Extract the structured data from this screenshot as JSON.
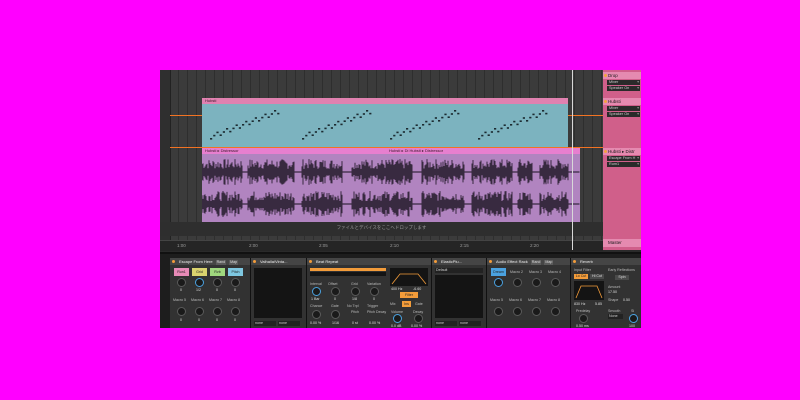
{
  "arrangement": {
    "midi_clip_name": "Hubsti",
    "audio_clip_names": [
      "Hubsti ▸ Distressor",
      "Hubsti ▸ Di Hubsti ▸ Distressor"
    ],
    "drop_hint": "ファイルとデバイスをここへドロップします",
    "ruler_ticks": [
      "1:00",
      "2:00",
      "2:05",
      "2:10",
      "2:15",
      "2:20"
    ]
  },
  "tracks": [
    {
      "title": "Drop",
      "items": [
        "Mixer",
        "Speaker On"
      ]
    },
    {
      "title": "Hubsti",
      "items": [
        "Mixer",
        "Speaker On"
      ]
    },
    {
      "title": "Hubsti ▸ Distr",
      "items": [
        "Escape From H",
        "Rum1"
      ]
    }
  ],
  "master_label": "Master",
  "devices": {
    "rack1": {
      "title": "Escape From Here",
      "rand": "Rand",
      "map": "Map",
      "macro_buttons": [
        "Run1",
        "Grid",
        "Rvb",
        "Pitch"
      ],
      "macro_values": [
        "0",
        "1/2",
        "0",
        "0"
      ],
      "macro_labels": [
        "Macro 5",
        "Macro 6",
        "Macro 7",
        "Macro 8"
      ],
      "macro_values2": [
        "0",
        "0",
        "0",
        "0"
      ]
    },
    "variable": {
      "title": "Valhalla/Vinta...",
      "dropdowns": [
        "none",
        "none"
      ]
    },
    "beat_repeat": {
      "title": "Beat Repeat",
      "row1": [
        "Interval",
        "Offset",
        "Grid",
        "Variation"
      ],
      "row1_vals": [
        "1 Bar",
        "0",
        "1/8",
        "0"
      ],
      "row2": [
        "Chance",
        "Gate",
        "No Trpl",
        "Trigger"
      ],
      "row2_vals": [
        "0.00 %",
        "1/16",
        "",
        ""
      ],
      "pitch_labels": [
        "Pitch",
        "Pitch Decay"
      ],
      "pitch_vals": [
        "0 st",
        "0.00 %"
      ]
    },
    "filter": {
      "freq": "400 Hz",
      "gain": "-6.60",
      "filter_label": "Filter",
      "mix_labels": [
        "Mix",
        "Ins",
        "Gate"
      ],
      "vol_labels": [
        "Volume",
        "Decay"
      ],
      "vol_vals": [
        "0.0 dB",
        "0.00 %"
      ]
    },
    "elastic": {
      "title": "ElasticPlu...",
      "preset": "Default",
      "dropdowns": [
        "none",
        "none"
      ]
    },
    "rack2": {
      "title": "Audio Effect Rack",
      "rand": "Rand",
      "map": "Map",
      "buttons": [
        "Dream",
        "Macro 2",
        "Macro 3",
        "Macro 4"
      ],
      "labels": [
        "Macro 5",
        "Macro 6",
        "Macro 7",
        "Macro 8"
      ]
    },
    "reverb": {
      "title": "Reverb",
      "input_label": "Input Filter",
      "lo_cut": "Lo Cut",
      "hi_cut": "Hi Cut",
      "freq": "830 Hz",
      "width": "5.85",
      "early_label": "Early Reflections",
      "spin": "Spin",
      "amount_label": "Amount",
      "amount_val": "17.50",
      "shape_label": "Shape",
      "shape_val": "0.50",
      "predelay_label": "Predelay",
      "predelay_val": "0.50 ms",
      "smooth_label": "Smooth",
      "smooth_val": "None",
      "size_label": "Si",
      "size_val": "100"
    }
  },
  "colors": {
    "midi_clip": "#7cb3bf",
    "audio_clip": "#b184c0",
    "accent_orange": "#f39c3a",
    "knob_blue": "#4aa2e0",
    "track_header": "#d05f8a",
    "background": "#ff00ff"
  }
}
